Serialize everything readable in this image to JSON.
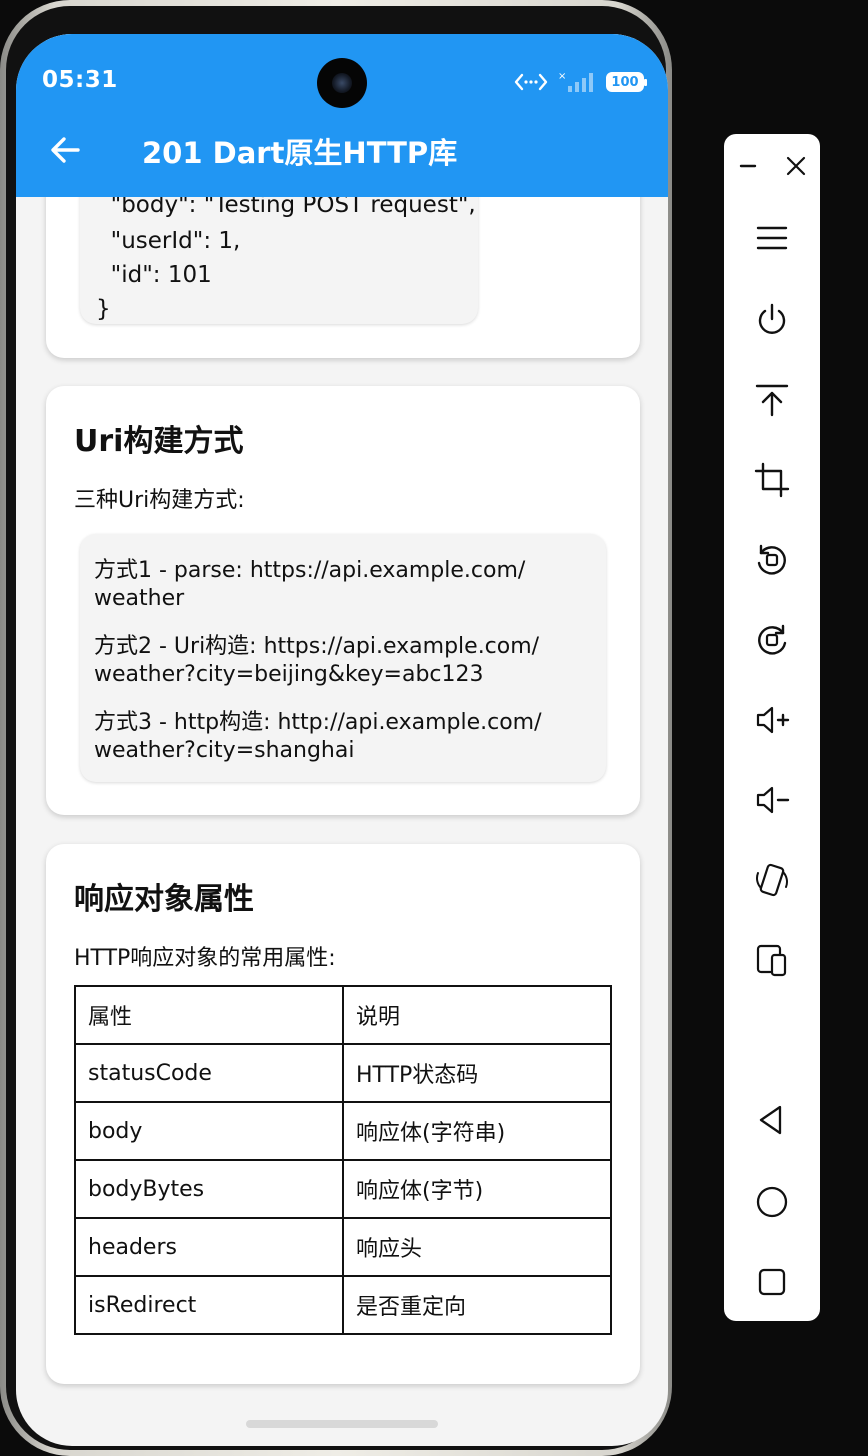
{
  "status_bar": {
    "time": "05:31",
    "battery": "100"
  },
  "app_bar": {
    "title": "201 Dart原生HTTP库"
  },
  "json_card": {
    "lines": [
      "  \"body\": \"Testing POST request\",",
      "  \"userId\": 1,",
      "  \"id\": 101",
      "}"
    ]
  },
  "uri_card": {
    "title": "Uri构建方式",
    "description": "三种Uri构建方式:",
    "items": [
      {
        "line1": "方式1 - parse: https://api.example.com/",
        "line2": "weather"
      },
      {
        "line1": "方式2 - Uri构造: https://api.example.com/",
        "line2": "weather?city=beijing&key=abc123"
      },
      {
        "line1": "方式3 - http构造: http://api.example.com/",
        "line2": "weather?city=shanghai"
      }
    ]
  },
  "response_card": {
    "title": "响应对象属性",
    "description": "HTTP响应对象的常用属性:",
    "rows": [
      {
        "name": "属性",
        "desc": "说明"
      },
      {
        "name": "statusCode",
        "desc": "HTTP状态码"
      },
      {
        "name": "body",
        "desc": "响应体(字符串)"
      },
      {
        "name": "bodyBytes",
        "desc": "响应体(字节)"
      },
      {
        "name": "headers",
        "desc": "响应头"
      },
      {
        "name": "isRedirect",
        "desc": "是否重定向"
      }
    ]
  },
  "toolbar": {
    "icons": [
      "minimize-icon",
      "close-icon",
      "menu-icon",
      "power-icon",
      "pin-top-icon",
      "crop-icon",
      "rotate-left-icon",
      "rotate-right-icon",
      "volume-up-icon",
      "volume-down-icon",
      "shake-icon",
      "multi-device-icon",
      "back-icon",
      "home-icon",
      "recents-icon"
    ]
  },
  "colors": {
    "app_bar": "#2196f3",
    "background": "#f4f4f4",
    "card": "#ffffff"
  }
}
